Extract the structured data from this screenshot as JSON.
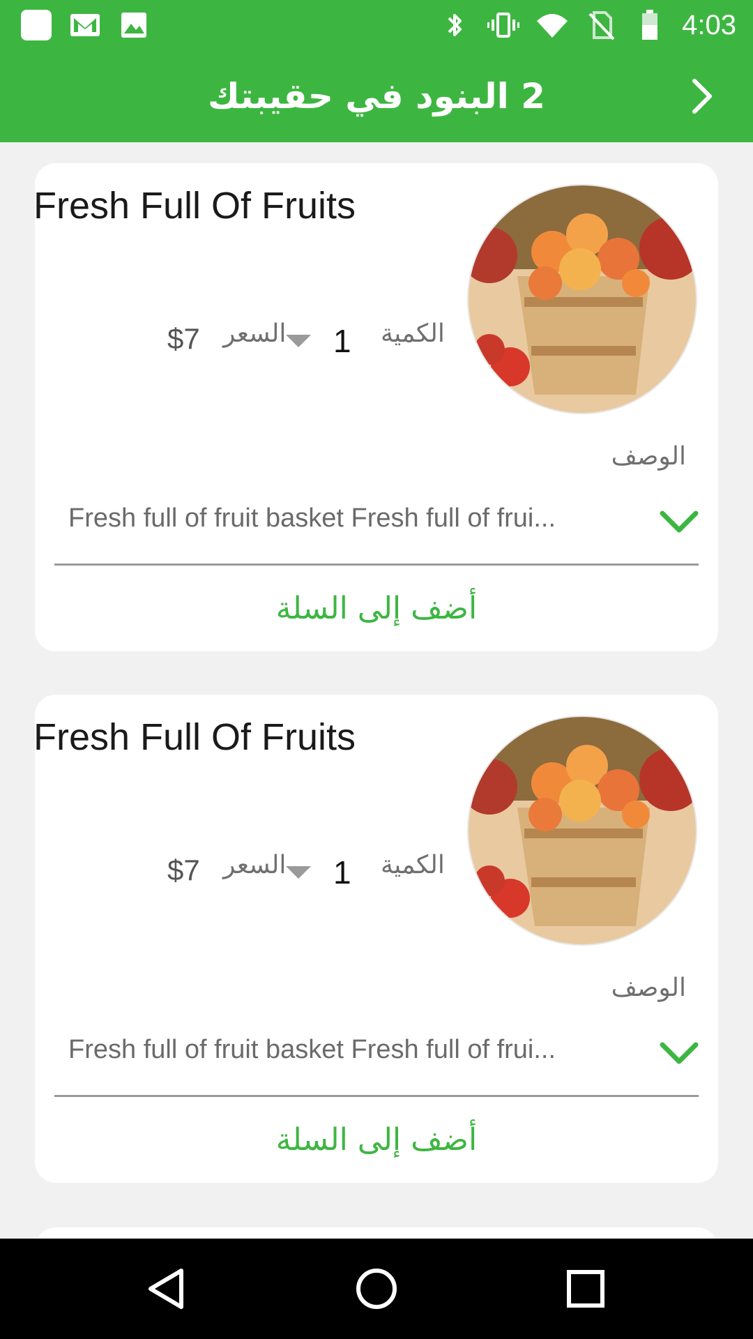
{
  "status_bar": {
    "time": "4:03",
    "left_icons": [
      "app-square-icon",
      "gmail-icon",
      "image-icon"
    ],
    "right_icons": [
      "bluetooth-icon",
      "vibrate-icon",
      "wifi-icon",
      "no-sim-icon",
      "battery-icon"
    ]
  },
  "app_bar": {
    "title": "2 البنود في حقيبتك",
    "nav_icon": "chevron-right-icon"
  },
  "items": [
    {
      "title": "Fresh Full Of Fruits",
      "quantity_label": "الكمية",
      "quantity": "1",
      "price_label": "السعر",
      "price": "$7",
      "description_label": "الوصف",
      "description": "Fresh full of fruit basket Fresh full of frui...",
      "add_to_cart": "أضف إلى السلة"
    },
    {
      "title": "Fresh Full Of Fruits",
      "quantity_label": "الكمية",
      "quantity": "1",
      "price_label": "السعر",
      "price": "$7",
      "description_label": "الوصف",
      "description": "Fresh full of fruit basket Fresh full of frui...",
      "add_to_cart": "أضف إلى السلة"
    }
  ],
  "colors": {
    "accent": "#3db641",
    "background": "#f1f1f1",
    "card": "#ffffff"
  }
}
